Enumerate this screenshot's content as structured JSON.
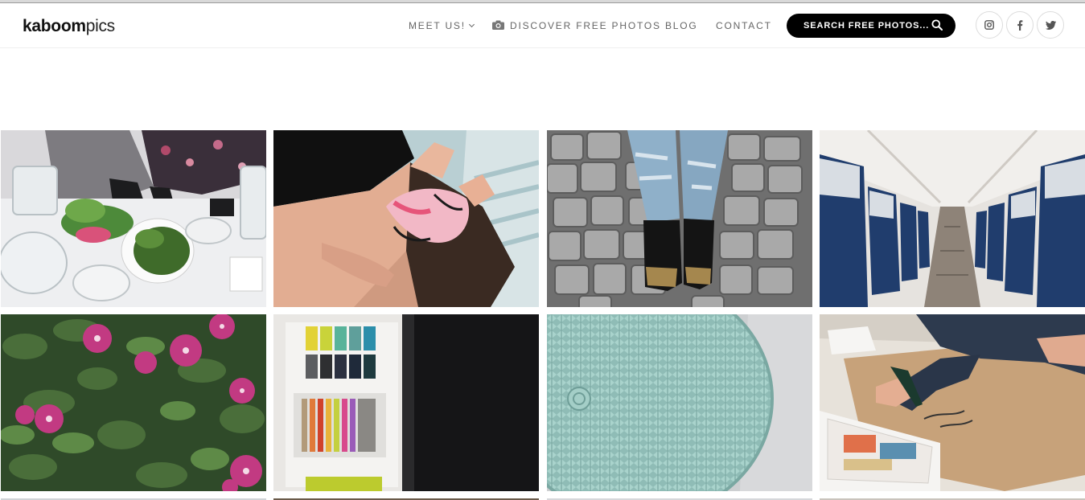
{
  "brand": {
    "bold": "kaboom",
    "light": "pics"
  },
  "nav": {
    "meet_us": "MEET US!",
    "discover": "DISCOVER FREE PHOTOS",
    "blog": "BLOG",
    "contact": "CONTACT"
  },
  "search": {
    "label": "SEARCH FREE PHOTOS..."
  },
  "social": {
    "instagram": "instagram-icon",
    "facebook": "facebook-icon",
    "twitter": "twitter-icon"
  },
  "colors": {
    "search_bg": "#000000",
    "nav_text": "#666666",
    "border": "#dcdcdc"
  },
  "photos": [
    {
      "name": "photo-terrarium-workshop",
      "subject": "terrarium workshop"
    },
    {
      "name": "photo-sleep-mask",
      "subject": "woman with sleep mask"
    },
    {
      "name": "photo-cobblestone-shoes",
      "subject": "jeans and shoes on cobblestone"
    },
    {
      "name": "photo-airplane-aisle",
      "subject": "airplane aisle"
    },
    {
      "name": "photo-clematis-flowers",
      "subject": "pink clematis flowers"
    },
    {
      "name": "photo-fabric-swatches",
      "subject": "fabric swatches"
    },
    {
      "name": "photo-crochet-pouf",
      "subject": "mint crochet pouf"
    },
    {
      "name": "photo-drawing-paper",
      "subject": "hand drawing on kraft paper"
    }
  ]
}
